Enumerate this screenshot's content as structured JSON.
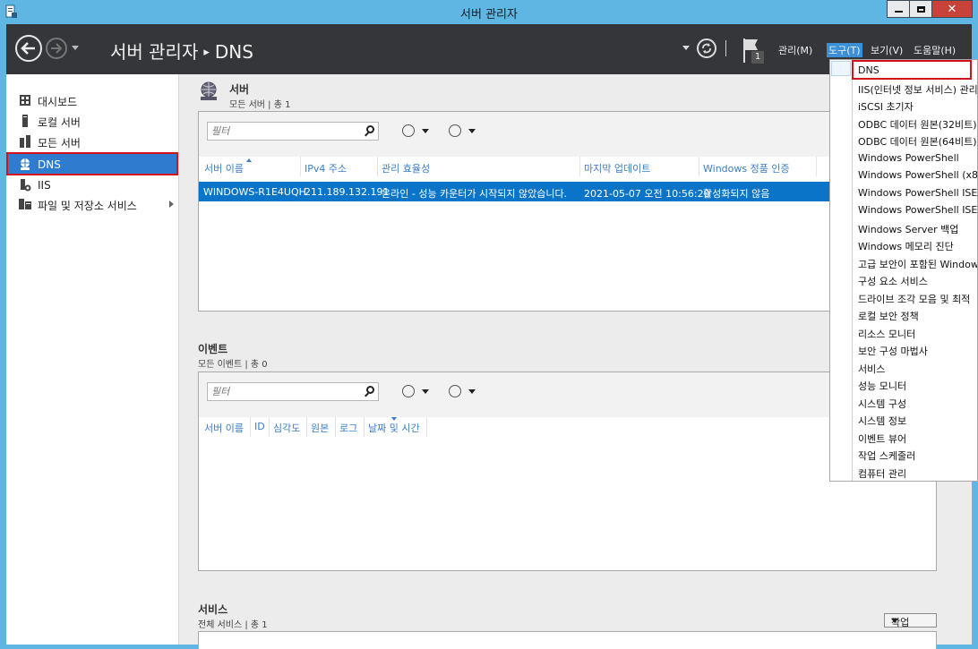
{
  "window": {
    "title": "서버 관리자"
  },
  "toolbar": {
    "breadcrumb_root": "서버 관리자",
    "breadcrumb_sep": "▸",
    "breadcrumb_current": "DNS",
    "notification_count": "1",
    "menus": [
      {
        "label": "관리(M)"
      },
      {
        "label": "도구(T)"
      },
      {
        "label": "보기(V)"
      },
      {
        "label": "도움말(H)"
      }
    ]
  },
  "sidebar": {
    "items": [
      {
        "label": "대시보드",
        "icon": "dashboard-icon"
      },
      {
        "label": "로컬 서버",
        "icon": "local-server-icon"
      },
      {
        "label": "모든 서버",
        "icon": "all-servers-icon"
      },
      {
        "label": "DNS",
        "icon": "dns-icon"
      },
      {
        "label": "IIS",
        "icon": "iis-icon"
      },
      {
        "label": "파일 및 저장소 서비스",
        "icon": "file-storage-icon"
      }
    ]
  },
  "servers": {
    "title": "서버",
    "subtitle": "모든 서버 | 총 1",
    "filter_placeholder": "필터",
    "columns": [
      "서버 이름",
      "IPv4 주소",
      "관리 효율성",
      "마지막 업데이트",
      "Windows 정품 인증"
    ],
    "rows": [
      [
        "WINDOWS-R1E4UQH",
        "211.189.132.191",
        "온라인 - 성능 카운터가 시작되지 않았습니다.",
        "2021-05-07 오전 10:56:20",
        "활성화되지 않음"
      ]
    ]
  },
  "events": {
    "title": "이벤트",
    "subtitle": "모든 이벤트 | 총 0",
    "filter_placeholder": "필터",
    "columns": [
      "서버 이름",
      "ID",
      "심각도",
      "원본",
      "로그",
      "날짜 및 시간"
    ]
  },
  "services": {
    "title": "서비스",
    "subtitle": "전체 서비스 | 총 1",
    "task_label": "작업"
  },
  "tools_menu": {
    "items": [
      "DNS",
      "IIS(인터넷 정보 서비스) 관리",
      "iSCSI 초기자",
      "ODBC 데이터 원본(32비트)",
      "ODBC 데이터 원본(64비트)",
      "Windows PowerShell",
      "Windows PowerShell (x86)",
      "Windows PowerShell ISE",
      "Windows PowerShell ISE (x8",
      "Windows Server 백업",
      "Windows 메모리 진단",
      "고급 보안이 포함된 Window",
      "구성 요소 서비스",
      "드라이브 조각 모음 및 최적",
      "로컬 보안 정책",
      "리소스 모니터",
      "보안 구성 마법사",
      "서비스",
      "성능 모니터",
      "시스템 구성",
      "시스템 정보",
      "이벤트 뷰어",
      "작업 스케줄러",
      "컴퓨터 관리"
    ]
  }
}
